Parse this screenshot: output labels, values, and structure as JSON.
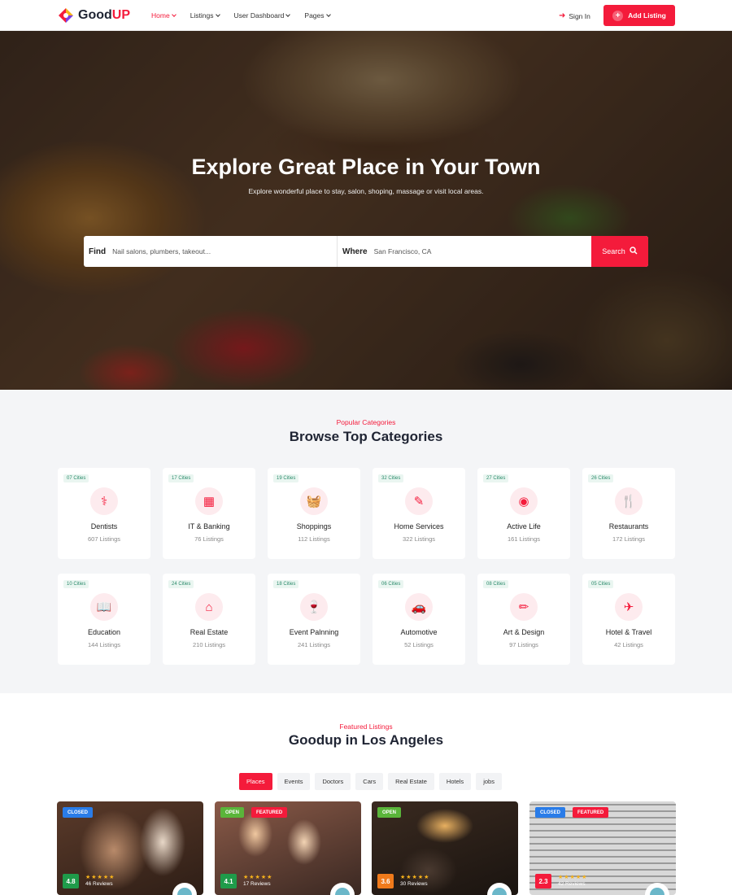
{
  "header": {
    "logo": {
      "text_main": "Good",
      "text_accent": "UP"
    },
    "nav": [
      {
        "label": "Home",
        "active": true
      },
      {
        "label": "Listings",
        "active": false
      },
      {
        "label": "User Dashboard",
        "active": false
      },
      {
        "label": "Pages",
        "active": false
      }
    ],
    "sign_in": "Sign In",
    "add_listing": "Add Listing"
  },
  "hero": {
    "title": "Explore Great Place in Your Town",
    "subtitle": "Explore wonderful place to stay, salon, shoping, massage or visit local areas.",
    "search": {
      "find_label": "Find",
      "find_placeholder": "Nail salons, plumbers, takeout...",
      "where_label": "Where",
      "where_value": "San Francisco, CA",
      "button": "Search"
    }
  },
  "categories": {
    "kicker": "Popular Categories",
    "title": "Browse Top Categories",
    "items": [
      {
        "cities": "07 Cities",
        "name": "Dentists",
        "count": "607 Listings",
        "icon": "stethoscope-icon",
        "glyph": "⚕"
      },
      {
        "cities": "17 Cities",
        "name": "IT & Banking",
        "count": "76 Listings",
        "icon": "building-icon",
        "glyph": "▦"
      },
      {
        "cities": "19 Cities",
        "name": "Shoppings",
        "count": "112 Listings",
        "icon": "basket-icon",
        "glyph": "🧺"
      },
      {
        "cities": "32 Cities",
        "name": "Home Services",
        "count": "322 Listings",
        "icon": "tool-icon",
        "glyph": "✎"
      },
      {
        "cities": "27 Cities",
        "name": "Active Life",
        "count": "161 Listings",
        "icon": "basketball-icon",
        "glyph": "◉"
      },
      {
        "cities": "26 Cities",
        "name": "Restaurants",
        "count": "172 Listings",
        "icon": "utensils-icon",
        "glyph": "🍴"
      },
      {
        "cities": "10 Cities",
        "name": "Education",
        "count": "144 Listings",
        "icon": "book-icon",
        "glyph": "📖"
      },
      {
        "cities": "24 Cities",
        "name": "Real Estate",
        "count": "210 Listings",
        "icon": "house-icon",
        "glyph": "⌂"
      },
      {
        "cities": "18 Cities",
        "name": "Event Palnning",
        "count": "241 Listings",
        "icon": "glass-icon",
        "glyph": "🍷"
      },
      {
        "cities": "06 Cities",
        "name": "Automotive",
        "count": "52 Listings",
        "icon": "car-icon",
        "glyph": "🚗"
      },
      {
        "cities": "08 Cities",
        "name": "Art & Design",
        "count": "97 Listings",
        "icon": "pencil-ruler-icon",
        "glyph": "✏"
      },
      {
        "cities": "05 Cities",
        "name": "Hotel & Travel",
        "count": "42 Listings",
        "icon": "plane-icon",
        "glyph": "✈"
      }
    ]
  },
  "featured": {
    "kicker": "Featured Listings",
    "title": "Goodup in Los Angeles",
    "tabs": [
      {
        "label": "Places",
        "active": true
      },
      {
        "label": "Events",
        "active": false
      },
      {
        "label": "Doctors",
        "active": false
      },
      {
        "label": "Cars",
        "active": false
      },
      {
        "label": "Real Estate",
        "active": false
      },
      {
        "label": "Hotels",
        "active": false
      },
      {
        "label": "jobs",
        "active": false
      }
    ],
    "listings": [
      {
        "status": "CLOSED",
        "featured": false,
        "rating": "4.8",
        "reviews": "46 Reviews",
        "rating_color": "#1f9b4a"
      },
      {
        "status": "OPEN",
        "featured": true,
        "featured_label": "FEATURED",
        "rating": "4.1",
        "reviews": "17 Reviews",
        "rating_color": "#1f9b4a"
      },
      {
        "status": "OPEN",
        "featured": false,
        "rating": "3.6",
        "reviews": "30 Reviews",
        "rating_color": "#f07a1b"
      },
      {
        "status": "CLOSED",
        "featured": true,
        "featured_label": "FEATURED",
        "rating": "2.3",
        "reviews": "42 Reviews",
        "rating_color": "#f41b3b"
      }
    ]
  },
  "colors": {
    "accent": "#f41b3b",
    "closed": "#2a7ce8",
    "open": "#5ab53a"
  }
}
